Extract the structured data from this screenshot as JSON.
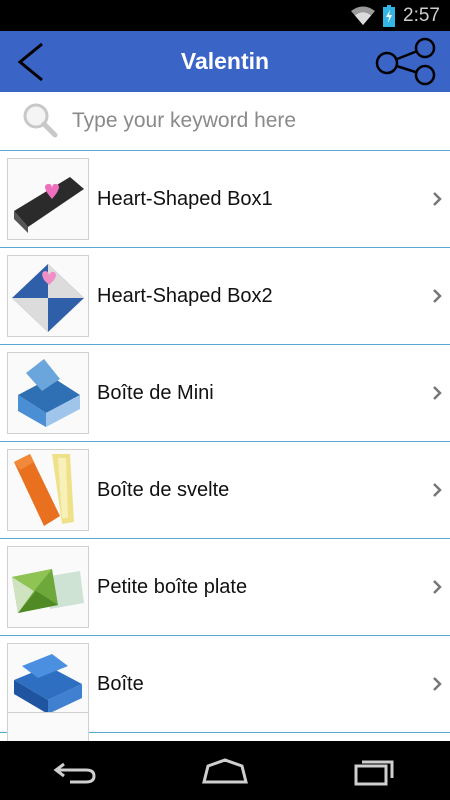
{
  "status": {
    "time": "2:57",
    "wifi_icon": "wifi-icon",
    "battery_icon": "battery-charging-icon"
  },
  "app_bar": {
    "title": "Valentin",
    "back_icon": "back-arrow-icon",
    "share_icon": "share-icon",
    "color": "#3a64c6"
  },
  "search": {
    "placeholder": "Type your keyword here",
    "value": "",
    "icon": "search-icon"
  },
  "items": [
    {
      "label": "Heart-Shaped Box1"
    },
    {
      "label": "Heart-Shaped Box2"
    },
    {
      "label": "Boîte de Mini"
    },
    {
      "label": "Boîte de svelte"
    },
    {
      "label": "Petite boîte plate"
    },
    {
      "label": "Boîte"
    }
  ],
  "nav": {
    "back_icon": "nav-back-icon",
    "home_icon": "nav-home-icon",
    "recents_icon": "nav-recents-icon"
  },
  "divider_color": "#5aa9cf"
}
